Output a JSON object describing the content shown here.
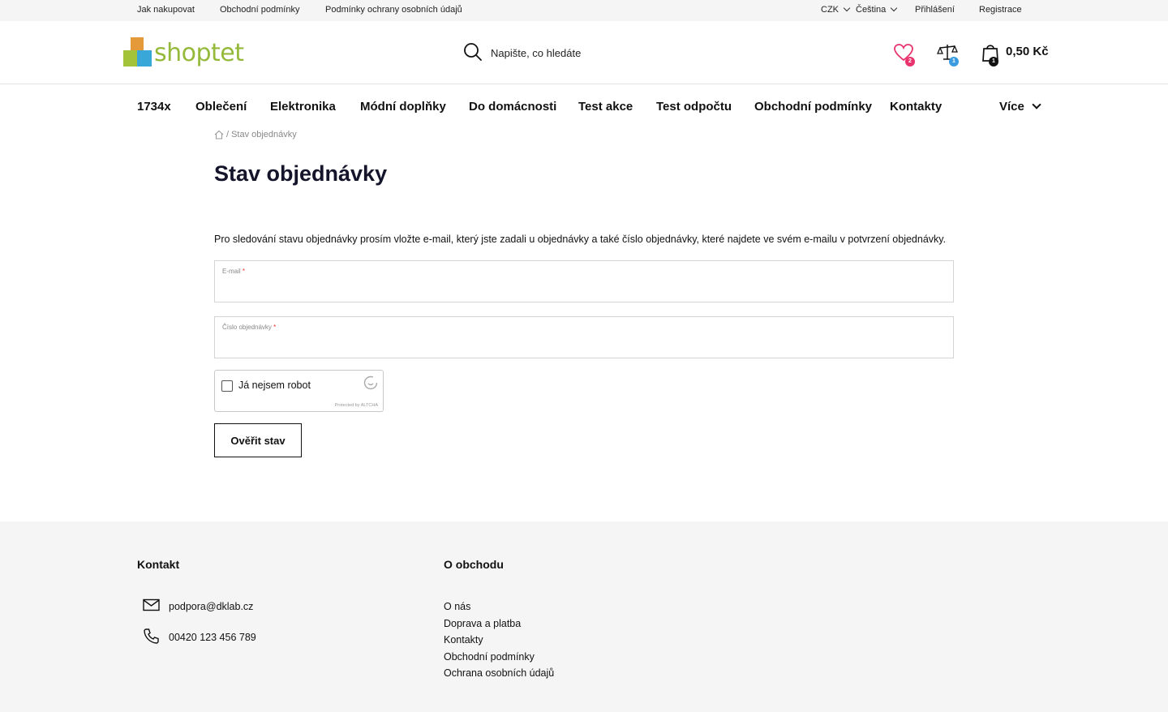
{
  "topbar": {
    "links": [
      "Jak nakupovat",
      "Obchodní podmínky",
      "Podmínky ochrany osobních údajů"
    ],
    "currency": "CZK",
    "language": "Čeština",
    "login": "Přihlášení",
    "register": "Registrace"
  },
  "header": {
    "logo_text": "shoptet",
    "search_placeholder": "Napište, co hledáte",
    "wishlist_count": "2",
    "compare_count": "1",
    "cart_count": "1",
    "cart_total": "0,50 Kč",
    "colors": {
      "wishlist": "#e8336d",
      "compare": "#3b9be0",
      "logo_green": "#95b93a",
      "logo_orange": "#e59a3a",
      "logo_blue": "#39a8d8"
    }
  },
  "nav": {
    "items": [
      "1734x",
      "Oblečení",
      "Elektronika",
      "Módní doplňky",
      "Do domácnosti",
      "Test akce",
      "Test odpočtu",
      "Obchodní podmínky",
      "Kontakty"
    ],
    "more": "Více"
  },
  "breadcrumb": {
    "current": "Stav objednávky"
  },
  "main": {
    "title": "Stav objednávky",
    "intro": "Pro sledování stavu objednávky prosím vložte e-mail, který jste zadali u objednávky a také číslo objednávky, které najdete ve svém e-mailu v potvrzení objednávky.",
    "email_label": "E-mail",
    "email_value": "",
    "order_label": "Číslo objednávky",
    "order_value": "",
    "required_mark": "*",
    "captcha_label": "Já nejsem robot",
    "captcha_protected": "Protected by ALTCHA",
    "submit": "Ověřit stav"
  },
  "footer": {
    "contact_heading": "Kontakt",
    "email": "podpora@dklab.cz",
    "phone": "00420 123 456 789",
    "about_heading": "O obchodu",
    "about_links": [
      "O nás",
      "Doprava a platba",
      "Kontakty",
      "Obchodní podmínky",
      "Ochrana osobních údajů"
    ]
  }
}
